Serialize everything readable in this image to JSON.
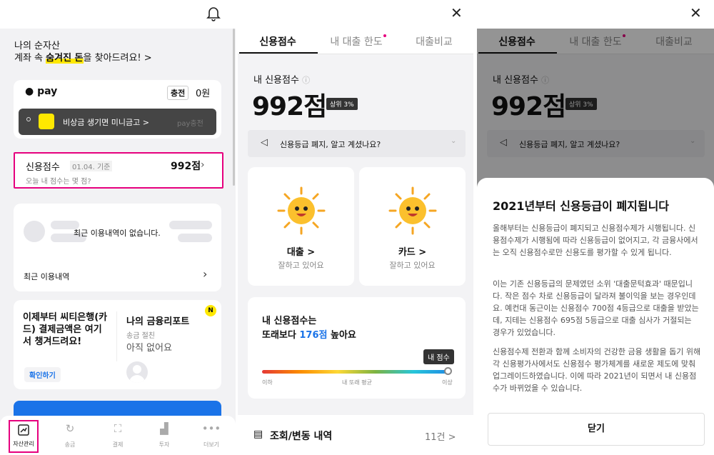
{
  "assets": {
    "header": {
      "title": "나의 순자산",
      "sub_prefix": "계좌 속 ",
      "sub_highlight": "숨겨진 돈",
      "sub_suffix": "을 찾아드려요! >"
    },
    "pay": {
      "logo": "pay",
      "charge_label": "충전",
      "balance": "0원",
      "banner": "비상금 생기면 미니금고 >",
      "banner_badge": "pay충전"
    },
    "credit": {
      "label": "신용점수",
      "date": "01.04. 기준",
      "score": "992점",
      "sub": "오늘 내 점수는 몇 점?"
    },
    "recent": {
      "empty": "최근 이용내역이 없습니다.",
      "link": "최근 이용내역"
    },
    "promo": {
      "text": "이제부터 씨티은행(카드) 결제금액은 여기서 챙겨드려요!",
      "btn": "확인하기"
    },
    "report": {
      "title": "나의 금융리포트",
      "sub": "송금 절친",
      "value": "아직 없어요",
      "badge": "N"
    },
    "nav": [
      {
        "label": "자산관리",
        "icon": "chart-up-icon"
      },
      {
        "label": "송금",
        "icon": "refresh-icon"
      },
      {
        "label": "결제",
        "icon": "scan-icon"
      },
      {
        "label": "투자",
        "icon": "bar-chart-icon"
      },
      {
        "label": "더보기",
        "icon": "more-icon"
      }
    ]
  },
  "credit_page": {
    "tabs": [
      "신용점수",
      "내 대출 한도",
      "대출비교"
    ],
    "score_label": "내 신용점수",
    "score": "992점",
    "rank": "상위 3%",
    "notice": "신용등급 폐지, 알고 계셨나요?",
    "cards": [
      {
        "title": "대출 >",
        "sub": "잘하고 있어요"
      },
      {
        "title": "카드 >",
        "sub": "잘하고 있어요"
      }
    ],
    "compare_line1": "내 신용점수는",
    "compare_prefix": "또래보다 ",
    "compare_value": "176점",
    "compare_suffix": " 높아요",
    "tooltip": "내 점수",
    "bar_labels": [
      "이하",
      "내 또래 평균",
      "이상"
    ],
    "bar_fill": 1.0,
    "history_label": "조회/변동 내역",
    "history_count": "11건 >"
  },
  "modal": {
    "title": "2021년부터 신용등급이 폐지됩니다",
    "p1": "올해부터는 신용등급이 폐지되고 신용점수제가 시행됩니다. 신용점수제가 시행됨에 따라 신용등급이 없어지고, 각 금융사에서는 오직 신용점수로만 신용도를 평가할 수 있게 됩니다.",
    "p2": "이는 기존 신용등급의 문제였던 소위 '대출문턱효과' 때문입니다. 작은 점수 차로 신용등급이 달라져 불이익을 보는 경우인데요. 예컨대 동근이는 신용점수 700점 4등급으로 대출을 받았는데, 지테는 신용점수 695점 5등급으로 대출 심사가 거절되는 경우가 있었습니다.",
    "p3": "신용점수제 전환과 함께 소비자의 건강한 금융 생활을 돕기 위해 각 신용평가사에서도 신용점수 평가체계를 새로운 제도에 맞춰 업그레이드하였습니다. 이에 따라 2021년이 되면서 내 신용점수가 바뀌었을 수 있습니다.",
    "close": "닫기"
  },
  "colors": {
    "accent": "#e6007e",
    "blue": "#1a73e8",
    "dark": "#111111",
    "yellow": "#ffe800"
  }
}
